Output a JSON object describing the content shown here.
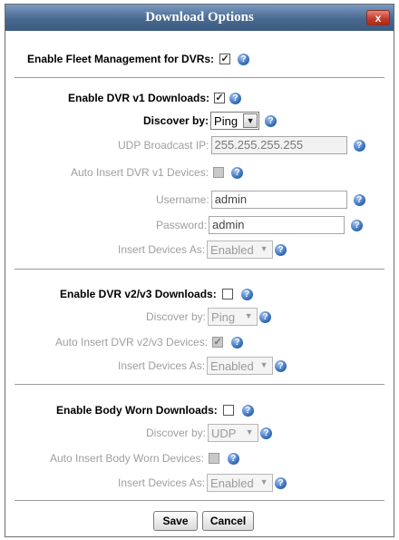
{
  "dialog": {
    "title": "Download Options",
    "close_glyph": "x"
  },
  "help_glyph": "?",
  "fleet": {
    "label": "Enable Fleet Management for DVRs:",
    "checked": true
  },
  "dvr1": {
    "enable_label": "Enable DVR v1 Downloads:",
    "discover_label": "Discover by:",
    "discover_value": "Ping",
    "udp_label": "UDP Broadcast IP:",
    "udp_value": "255.255.255.255",
    "auto_insert_label": "Auto Insert DVR v1 Devices:",
    "username_label": "Username:",
    "username_value": "admin",
    "password_label": "Password:",
    "password_value": "admin",
    "insert_as_label": "Insert Devices As:",
    "insert_as_value": "Enabled"
  },
  "dvr23": {
    "enable_label": "Enable DVR v2/v3 Downloads:",
    "discover_label": "Discover by:",
    "discover_value": "Ping",
    "auto_insert_label": "Auto Insert DVR v2/v3 Devices:",
    "insert_as_label": "Insert Devices As:",
    "insert_as_value": "Enabled"
  },
  "bodyworn": {
    "enable_label": "Enable Body Worn Downloads:",
    "discover_label": "Discover by:",
    "discover_value": "UDP",
    "auto_insert_label": "Auto Insert Body Worn Devices:",
    "insert_as_label": "Insert Devices As:",
    "insert_as_value": "Enabled"
  },
  "buttons": {
    "save": "Save",
    "cancel": "Cancel"
  },
  "check_glyph": "✓",
  "arrow_glyph": "▼"
}
